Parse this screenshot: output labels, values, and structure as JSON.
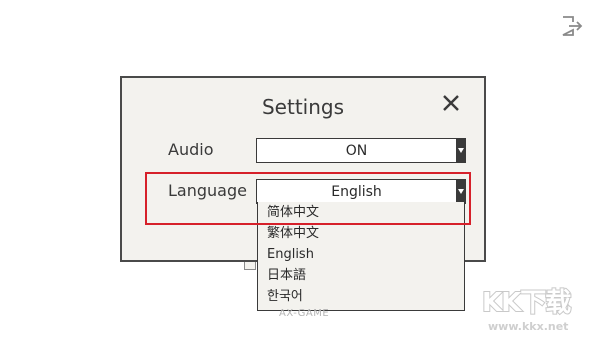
{
  "dialog": {
    "title": "Settings"
  },
  "audio": {
    "label": "Audio",
    "value": "ON"
  },
  "language": {
    "label": "Language",
    "value": "English",
    "options": [
      "简体中文",
      "繁体中文",
      "English",
      "日本語",
      "한국어"
    ]
  },
  "footer": {
    "text": "AX-GAME"
  },
  "watermark": {
    "logo": "KK下载",
    "url": "www.kkx.net"
  },
  "colors": {
    "highlight": "#d6202a",
    "dialog_bg": "#f3f2ee",
    "border": "#3a3a3a"
  },
  "icons": {
    "exit": "exit-icon",
    "close": "close-icon",
    "dropdown_arrow": "chevron-down-icon"
  }
}
